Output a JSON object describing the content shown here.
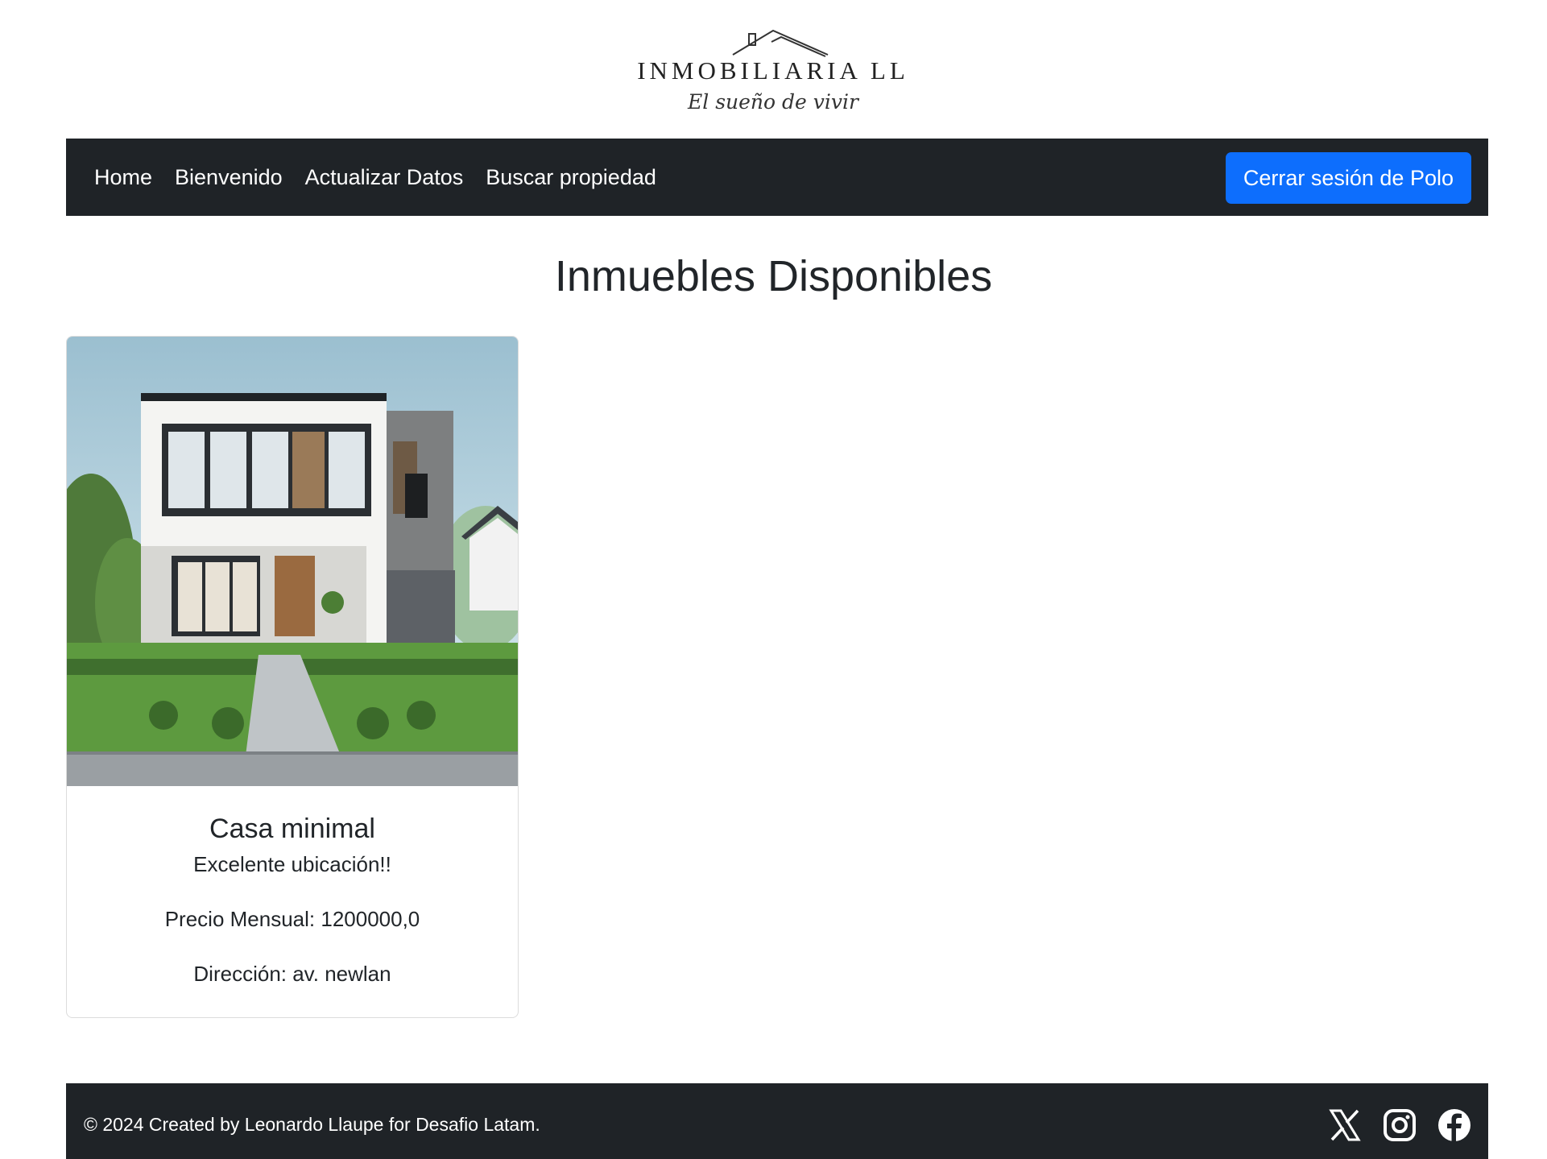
{
  "logo": {
    "title": "INMOBILIARIA LL",
    "tagline": "El sueño de vivir"
  },
  "nav": {
    "items": [
      {
        "label": "Home"
      },
      {
        "label": "Bienvenido"
      },
      {
        "label": "Actualizar Datos"
      },
      {
        "label": "Buscar propiedad"
      }
    ],
    "logout_label": "Cerrar sesión de Polo"
  },
  "main": {
    "title": "Inmuebles Disponibles",
    "properties": [
      {
        "name": "Casa minimal",
        "description": "Excelente ubicación!!",
        "price": "Precio Mensual: 1200000,0",
        "address": "Dirección: av. newlan"
      }
    ]
  },
  "footer": {
    "text": "© 2024 Created by Leonardo Llaupe for Desafio Latam.",
    "social": [
      "x-icon",
      "instagram-icon",
      "facebook-icon"
    ]
  },
  "colors": {
    "navbar": "#1f2327",
    "primary_button": "#0d6efd"
  }
}
